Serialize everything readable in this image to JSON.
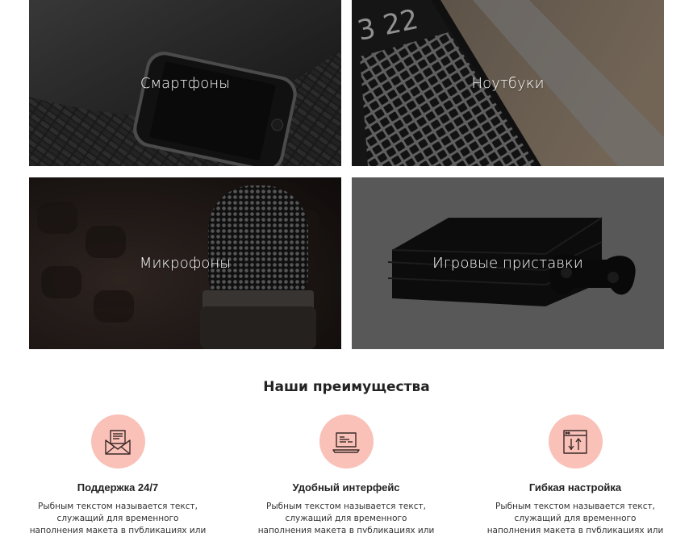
{
  "categories": [
    {
      "label": "Смартфоны"
    },
    {
      "label": "Ноутбуки"
    },
    {
      "label": "Микрофоны"
    },
    {
      "label": "Игровые приставки"
    }
  ],
  "advantages": {
    "title": "Наши преимущества",
    "items": [
      {
        "icon": "envelope-document-icon",
        "title": "Поддержка 24/7",
        "text": "Рыбным текстом называется текст, служащий для временного наполнения макета в публикациях или производстве"
      },
      {
        "icon": "laptop-code-icon",
        "title": "Удобный интерфейс",
        "text": "Рыбным текстом называется текст, служащий для временного наполнения макета в публикациях или производстве"
      },
      {
        "icon": "settings-window-icon",
        "title": "Гибкая настройка",
        "text": "Рыбным текстом называется текст, служащий для временного наполнения макета в публикациях или производстве"
      }
    ]
  },
  "colors": {
    "accent_circle": "#f9c1b8",
    "icon_stroke": "#3a2a28"
  }
}
